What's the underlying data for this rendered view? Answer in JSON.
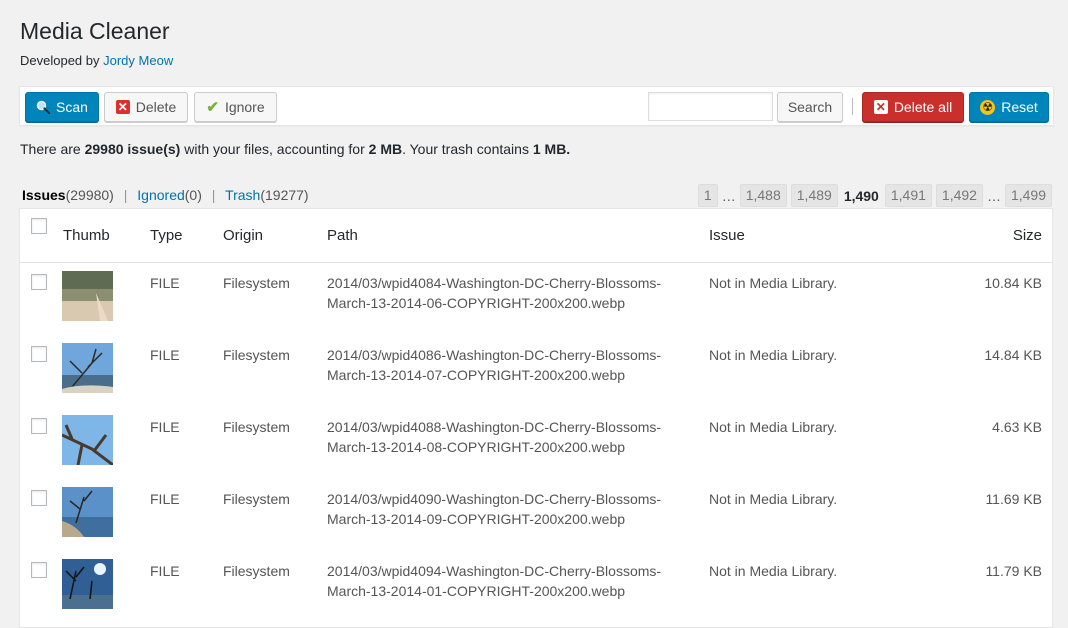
{
  "header": {
    "title": "Media Cleaner",
    "byline_prefix": "Developed by",
    "author": "Jordy Meow"
  },
  "toolbar": {
    "scan_label": "Scan",
    "delete_label": "Delete",
    "ignore_label": "Ignore",
    "search_value": "",
    "search_placeholder": "",
    "search_label": "Search",
    "delete_all_label": "Delete all",
    "reset_label": "Reset"
  },
  "summary": {
    "prefix": "There are",
    "issues": "29980 issue(s)",
    "middle": "with your files, accounting for",
    "size": "2 MB",
    "trash_text": ". Your trash contains",
    "trash_size": "1 MB."
  },
  "filters": {
    "issues_label": "Issues",
    "issues_count": "(29980)",
    "ignored_label": "Ignored",
    "ignored_count": "(0)",
    "trash_label": "Trash",
    "trash_count": "(19277)",
    "separator": "|"
  },
  "pagination": {
    "first": "1",
    "ellipsis": "…",
    "p1": "1,488",
    "p2": "1,489",
    "current": "1,490",
    "p3": "1,491",
    "p4": "1,492",
    "last": "1,499"
  },
  "table": {
    "columns": [
      "Thumb",
      "Type",
      "Origin",
      "Path",
      "Issue",
      "Size"
    ],
    "rows": [
      {
        "type": "FILE",
        "origin": "Filesystem",
        "path_line1": "2014/03/wpid4084-Washington-DC-Cherry-Blossoms-",
        "path_line2": "March-13-2014-06-COPYRIGHT-200x200.webp",
        "issue": "Not in Media Library.",
        "size": "10.84 KB"
      },
      {
        "type": "FILE",
        "origin": "Filesystem",
        "path_line1": "2014/03/wpid4086-Washington-DC-Cherry-Blossoms-",
        "path_line2": "March-13-2014-07-COPYRIGHT-200x200.webp",
        "issue": "Not in Media Library.",
        "size": "14.84 KB"
      },
      {
        "type": "FILE",
        "origin": "Filesystem",
        "path_line1": "2014/03/wpid4088-Washington-DC-Cherry-Blossoms-",
        "path_line2": "March-13-2014-08-COPYRIGHT-200x200.webp",
        "issue": "Not in Media Library.",
        "size": "4.63 KB"
      },
      {
        "type": "FILE",
        "origin": "Filesystem",
        "path_line1": "2014/03/wpid4090-Washington-DC-Cherry-Blossoms-",
        "path_line2": "March-13-2014-09-COPYRIGHT-200x200.webp",
        "issue": "Not in Media Library.",
        "size": "11.69 KB"
      },
      {
        "type": "FILE",
        "origin": "Filesystem",
        "path_line1": "2014/03/wpid4094-Washington-DC-Cherry-Blossoms-",
        "path_line2": "March-13-2014-01-COPYRIGHT-200x200.webp",
        "issue": "Not in Media Library.",
        "size": "11.79 KB"
      }
    ]
  },
  "colors": {
    "link": "#0073aa",
    "primary": "#0085ba",
    "danger": "#c9302c",
    "background": "#f1f1f1"
  },
  "icons": {
    "scan": "search-icon",
    "delete": "x-icon",
    "ignore": "check-icon",
    "delete_all": "x-icon",
    "reset": "radiation-icon"
  }
}
